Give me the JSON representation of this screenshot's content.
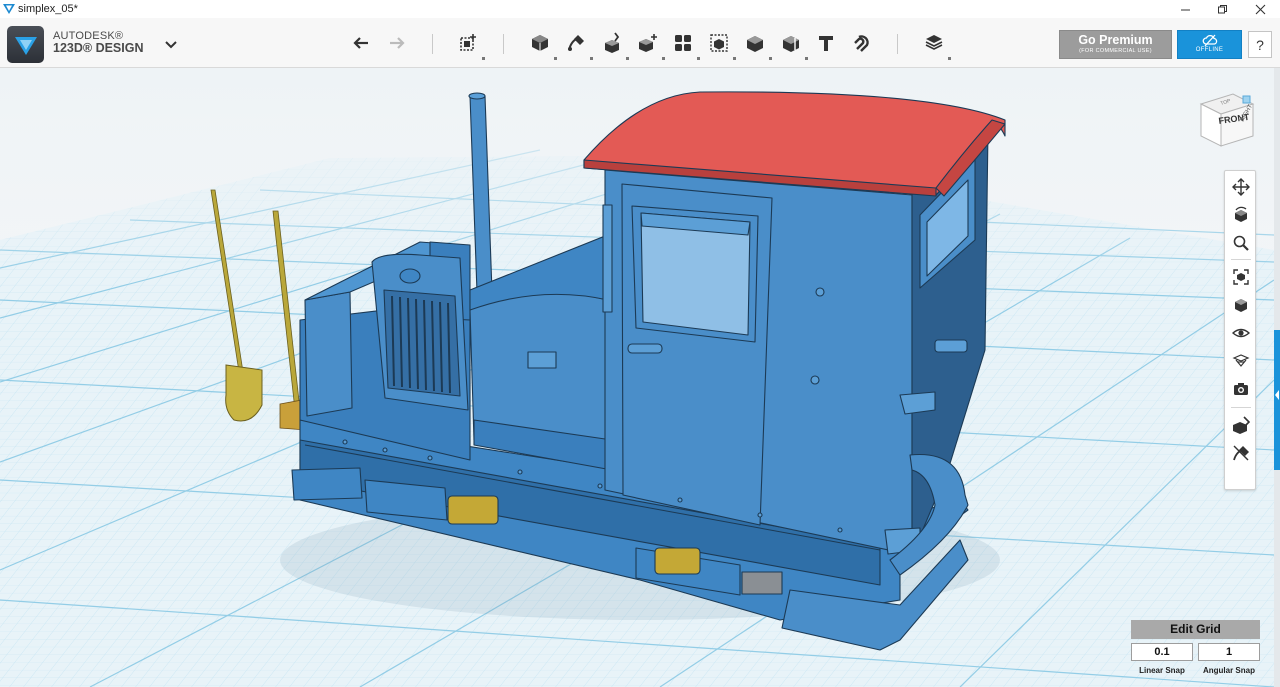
{
  "window": {
    "title": "simplex_05*"
  },
  "brand": {
    "line1": "AUTODESK®",
    "line2": "123D® DESIGN"
  },
  "toolbar": {
    "tools": [
      "undo-icon",
      "redo-icon",
      "primitives-icon",
      "sketch-icon",
      "construct-icon",
      "modify-icon",
      "pattern-icon",
      "group-icon",
      "combine-icon",
      "measure-icon",
      "text-icon",
      "snap-icon",
      "material-icon"
    ]
  },
  "account": {
    "premium_label": "Go Premium",
    "premium_sub": "(FOR COMMERCIAL USE)",
    "offline_label": "OFFLINE",
    "help_label": "?"
  },
  "viewcube": {
    "front_label": "FRONT",
    "right_label": "RIGHT",
    "top_label": "TOP"
  },
  "navbar": {
    "tools": [
      "pan-icon",
      "orbit-icon",
      "zoom-icon",
      "fit-icon",
      "views-icon",
      "visibility-icon",
      "materials-outline-icon",
      "screenshot-icon",
      "solid-mode-icon",
      "hide-sketches-icon"
    ]
  },
  "grid": {
    "edit_label": "Edit Grid",
    "linear_snap": "0.1",
    "linear_snap_label": "Linear Snap",
    "angular_snap": "1",
    "angular_snap_label": "Angular Snap"
  },
  "colors": {
    "accent": "#1a93da",
    "model_body": "#4a8ec9",
    "roof": "#e35a55",
    "tools": "#c4b13d",
    "grid": "#93cde6"
  }
}
